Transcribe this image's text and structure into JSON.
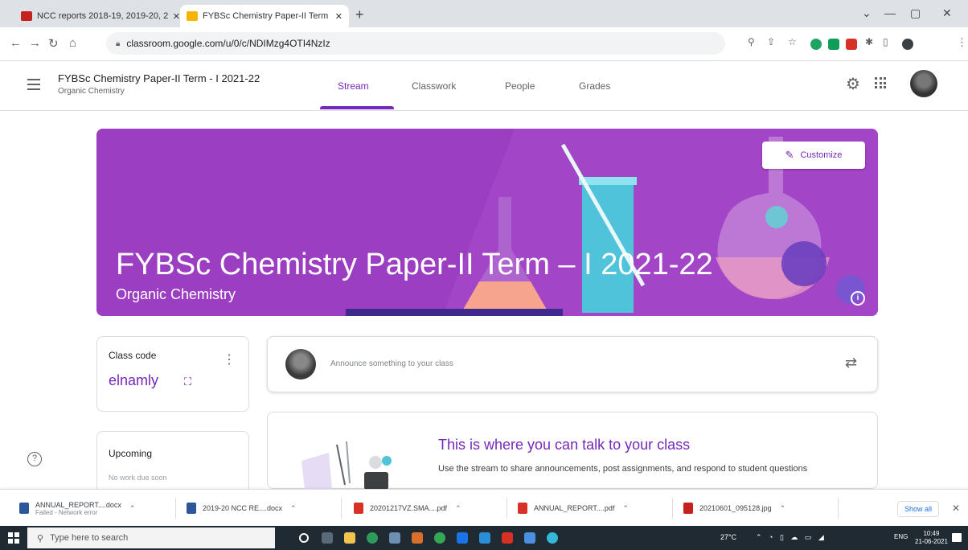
{
  "browser": {
    "tabs": [
      {
        "title": "NCC reports 2018-19, 2019-20, 2…",
        "favicon_color": "#c5221f"
      },
      {
        "title": "FYBSc Chemistry Paper-II Term",
        "favicon_color": "#f4b400"
      }
    ],
    "url": "classroom.google.com/u/0/c/NDIMzg4OTI4NzIz",
    "window_controls": [
      "⌄",
      "—",
      "▢",
      "✕"
    ]
  },
  "header": {
    "class_title": "FYBSc Chemistry Paper-II Term - I 2021-22",
    "class_subtitle": "Organic Chemistry",
    "tabs": [
      "Stream",
      "Classwork",
      "People",
      "Grades"
    ],
    "active_tab": "Stream"
  },
  "banner": {
    "title": "FYBSc Chemistry Paper-II Term – I 2021-22",
    "subtitle": "Organic Chemistry",
    "customize_label": "Customize",
    "background": "#9b3ec1"
  },
  "class_code": {
    "label": "Class code",
    "value": "elnamly"
  },
  "upcoming": {
    "label": "Upcoming",
    "note": "No work due soon"
  },
  "stream": {
    "announce_placeholder": "Announce something to your class",
    "empty_title": "This is where you can talk to your class",
    "empty_body": "Use the stream to share announcements, post assignments, and respond to student questions"
  },
  "downloads": {
    "items": [
      {
        "name": "ANNUAL_REPORT....docx",
        "sub": "Failed - Network error",
        "icon_color": "#2b579a"
      },
      {
        "name": "2019-20 NCC RE....docx",
        "sub": "",
        "icon_color": "#2b579a"
      },
      {
        "name": "20201217VZ.SMA....pdf",
        "sub": "",
        "icon_color": "#d93025"
      },
      {
        "name": "ANNUAL_REPORT....pdf",
        "sub": "",
        "icon_color": "#d93025"
      },
      {
        "name": "20210601_095128.jpg",
        "sub": "",
        "icon_color": "#c5221f"
      }
    ],
    "show_all": "Show all"
  },
  "taskbar": {
    "search_placeholder": "Type here to search",
    "temperature": "27°C",
    "language": "ENG",
    "time": "10:49",
    "date": "21-06-2021"
  },
  "colors": {
    "accent": "#7627bb",
    "banner": "#9b3ec1",
    "taskbar": "#1f2a33"
  }
}
